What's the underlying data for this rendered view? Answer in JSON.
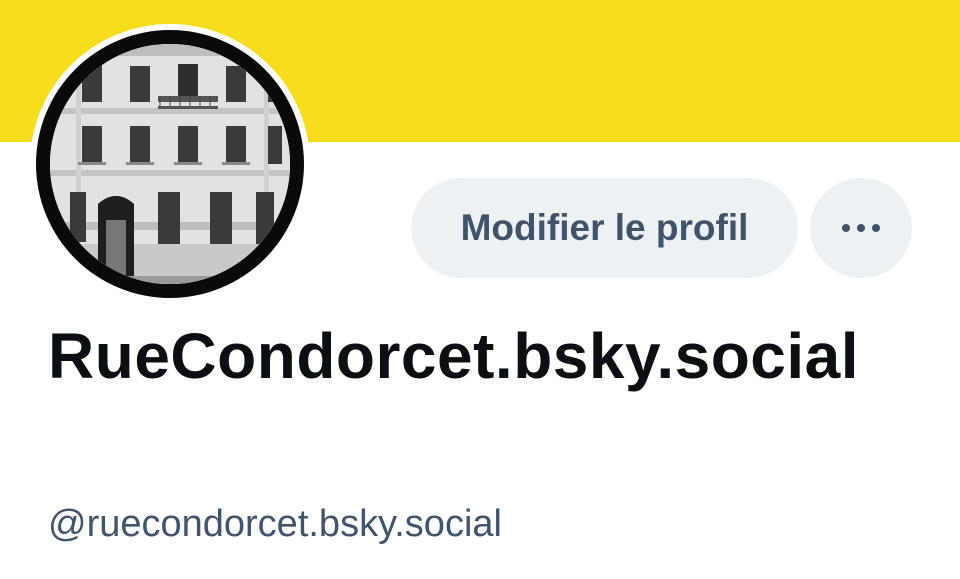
{
  "banner": {
    "color": "#f6dc1c"
  },
  "avatar": {
    "icon": "building-photo"
  },
  "actions": {
    "edit_label": "Modifier le profil",
    "more_icon": "ellipsis-icon"
  },
  "profile": {
    "display_name": "RueCondorcet.bsky.social",
    "handle": "@ruecondorcet.bsky.social"
  },
  "colors": {
    "accent_text": "#41536a",
    "button_bg": "#eef1f4",
    "name_text": "#0b0f14"
  }
}
